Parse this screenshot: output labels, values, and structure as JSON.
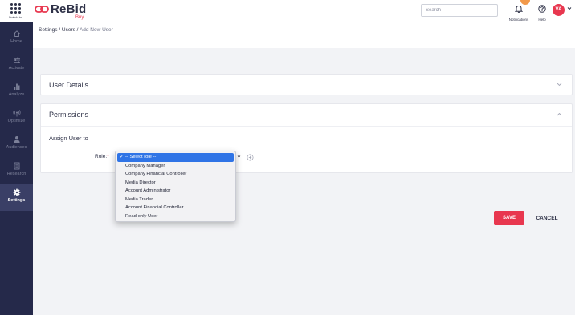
{
  "topbar": {
    "switch_label": "Switch to",
    "logo_text": "ReBid",
    "logo_sub": "Buy",
    "search_placeholder": "Search",
    "notifications_label": "Notifications",
    "help_label": "Help",
    "avatar_initials": "VA"
  },
  "colors": {
    "accent": "#e8374f",
    "sidebar_bg": "#25294a",
    "sidebar_active": "#3a3f66",
    "selection": "#2f74e6",
    "badge": "#f2994a"
  },
  "sidebar": {
    "items": [
      {
        "label": "Home",
        "icon": "home-icon",
        "active": false
      },
      {
        "label": "Activate",
        "icon": "sliders-icon",
        "active": false
      },
      {
        "label": "Analyze",
        "icon": "bar-chart-icon",
        "active": false
      },
      {
        "label": "Optimize",
        "icon": "broadcast-icon",
        "active": false
      },
      {
        "label": "Audiences",
        "icon": "person-icon",
        "active": false
      },
      {
        "label": "Research",
        "icon": "document-icon",
        "active": false
      },
      {
        "label": "Settings",
        "icon": "gear-icon",
        "active": true
      }
    ]
  },
  "breadcrumb": {
    "part1": "Settings / Users / ",
    "current": "Add New User"
  },
  "sections": {
    "user_details": "User Details",
    "permissions": "Permissions"
  },
  "permissions": {
    "assign_label": "Assign User to",
    "role_label": "Role:",
    "required_mark": "*",
    "role_options": [
      "-- Select role --",
      "Company Manager",
      "Company Financial Controller",
      "Media Director",
      "Account Administrator",
      "Media Trader",
      "Account Financial Controller",
      "Read-only User"
    ],
    "selected_index": 0
  },
  "actions": {
    "save": "SAVE",
    "cancel": "CANCEL"
  }
}
